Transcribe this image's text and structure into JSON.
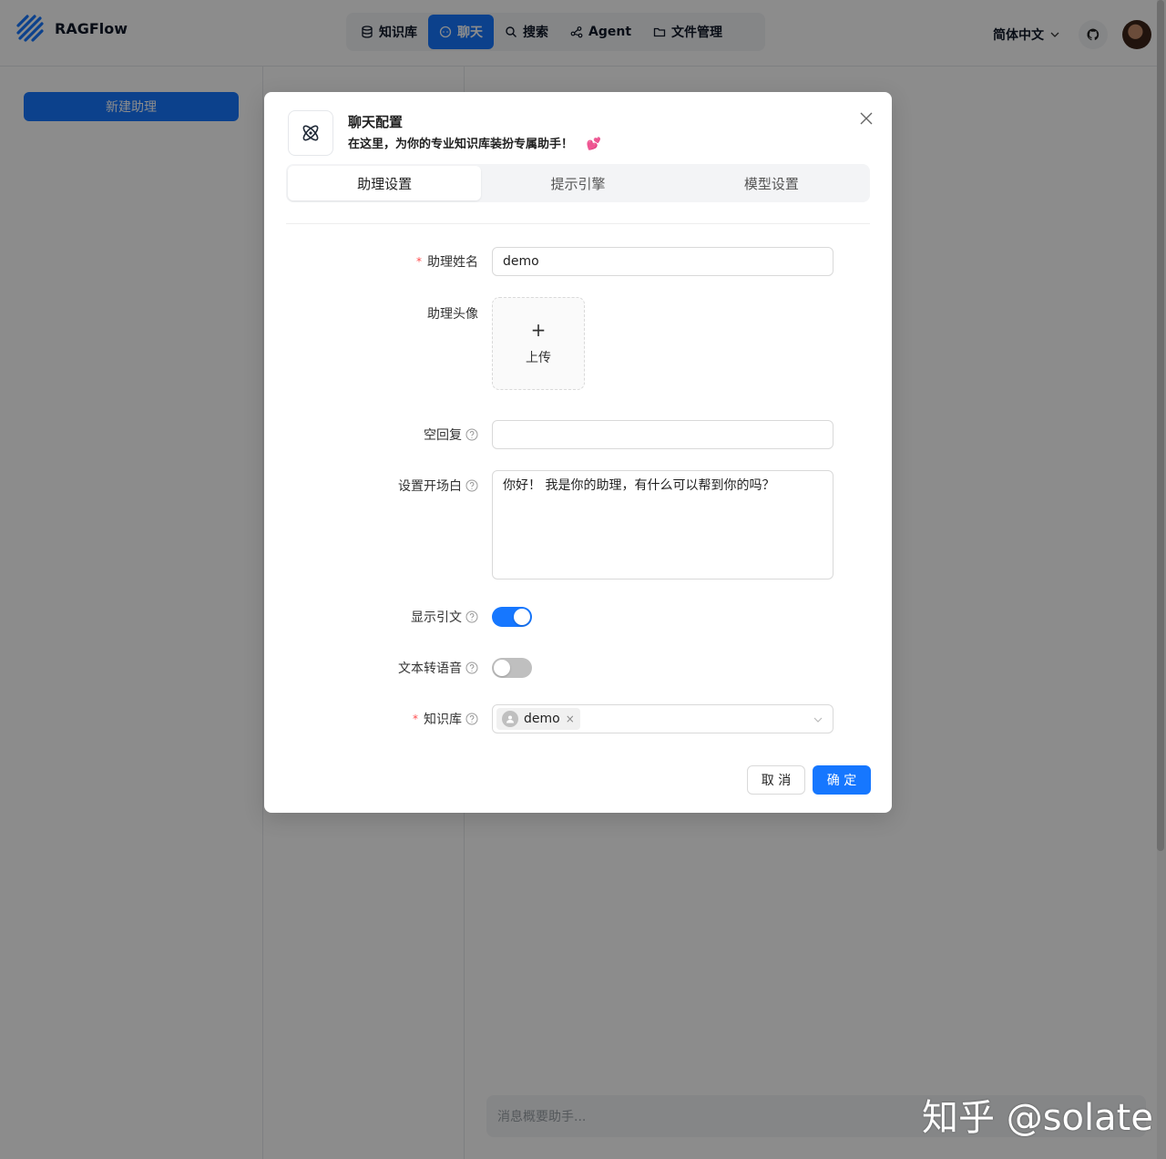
{
  "app": {
    "brand": "RAGFlow",
    "nav": [
      {
        "label": "知识库",
        "icon": "database-icon"
      },
      {
        "label": "聊天",
        "icon": "chat-icon",
        "active": true
      },
      {
        "label": "搜索",
        "icon": "search-icon"
      },
      {
        "label": "Agent",
        "icon": "agent-graph-icon"
      },
      {
        "label": "文件管理",
        "icon": "folder-icon"
      }
    ],
    "language": "简体中文",
    "new_assistant_label": "新建助理",
    "chat_placeholder": "消息概要助手..."
  },
  "modal": {
    "title": "聊天配置",
    "subtitle": "在这里，为你的专业知识库装扮专属助手！",
    "subtitle_emoji": "💕",
    "tabs": [
      {
        "label": "助理设置",
        "active": true
      },
      {
        "label": "提示引擎",
        "active": false
      },
      {
        "label": "模型设置",
        "active": false
      }
    ],
    "fields": {
      "name": {
        "label": "助理姓名",
        "required_mark": "*",
        "value": "demo"
      },
      "avatar": {
        "label": "助理头像",
        "upload_plus": "+",
        "upload_label": "上传"
      },
      "empty_reply": {
        "label": "空回复",
        "value": ""
      },
      "opener": {
        "label": "设置开场白",
        "value": "你好！ 我是你的助理，有什么可以帮到你的吗？"
      },
      "show_quote": {
        "label": "显示引文",
        "on": true
      },
      "tts": {
        "label": "文本转语音",
        "on": false
      },
      "knowledge_base": {
        "label": "知识库",
        "required_mark": "*",
        "selected_tag": "demo",
        "tag_close": "×"
      }
    },
    "cancel_label": "取 消",
    "ok_label": "确 定"
  },
  "colors": {
    "primary": "#1677ff",
    "required": "#ff4d4f",
    "overlay": "rgba(0,0,0,0.45)"
  },
  "watermark": "知乎 @solate"
}
